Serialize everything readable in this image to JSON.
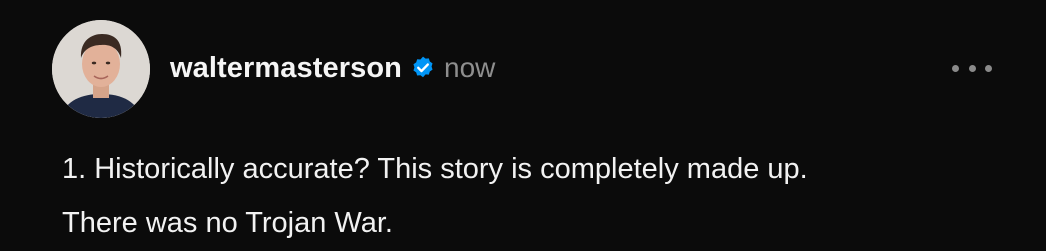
{
  "post": {
    "author": {
      "username": "waltermasterson",
      "verified": true,
      "avatar_icon": "profile-photo"
    },
    "timestamp": "now",
    "menu_icon": "more-options-icon",
    "text_lines": [
      "1. Historically accurate? This story is completely made up.",
      "There was no Trojan War."
    ]
  },
  "colors": {
    "background": "#0b0b0b",
    "text": "#f2f2f2",
    "muted": "#8e8e8e",
    "verified_blue": "#0095f6"
  }
}
